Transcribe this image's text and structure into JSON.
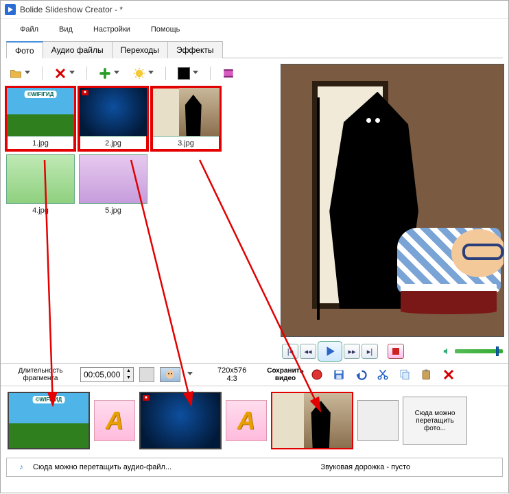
{
  "titlebar": {
    "title": "Bolide Slideshow Creator - *"
  },
  "menu": {
    "file": "Файл",
    "view": "Вид",
    "settings": "Настройки",
    "help": "Помощь"
  },
  "tabs": {
    "photo": "Фото",
    "audio": "Аудио файлы",
    "transitions": "Переходы",
    "effects": "Эффекты"
  },
  "library": {
    "items": [
      {
        "name": "1.jpg",
        "selected": true,
        "kind": "c1"
      },
      {
        "name": "2.jpg",
        "selected": true,
        "kind": "c2"
      },
      {
        "name": "3.jpg",
        "selected": true,
        "kind": "c3"
      },
      {
        "name": "4.jpg",
        "selected": false,
        "kind": "c4"
      },
      {
        "name": "5.jpg",
        "selected": false,
        "kind": "c5"
      }
    ]
  },
  "fragment": {
    "label": "Длительность фрагмента",
    "duration": "00:05,000",
    "resolution": "720x576",
    "aspect": "4:3"
  },
  "save": {
    "label1": "Сохранить",
    "label2": "видео"
  },
  "timeline": {
    "drop_hint": "Сюда можно перетащить фото..."
  },
  "audiobar": {
    "drag_hint": "Сюда можно перетащить аудио-файл...",
    "status": "Звуковая дорожка - пусто"
  }
}
